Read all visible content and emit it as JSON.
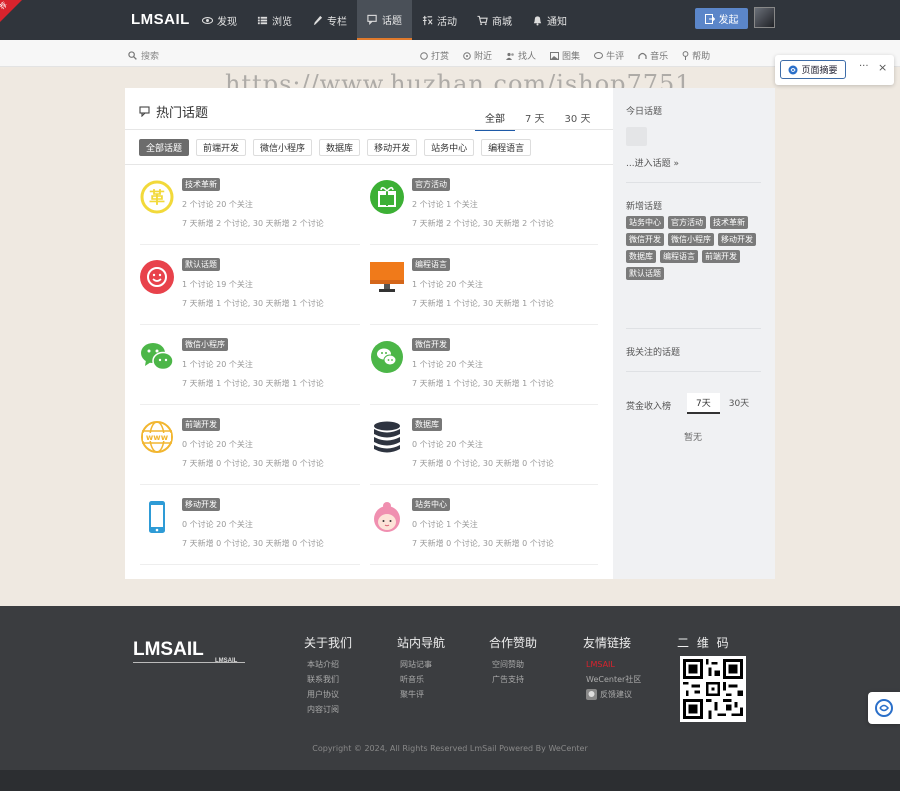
{
  "corner_badge": "荐",
  "header": {
    "logo": "LMSAIL",
    "nav": [
      {
        "label": "发现",
        "icon": "eye-icon"
      },
      {
        "label": "浏览",
        "icon": "list-icon"
      },
      {
        "label": "专栏",
        "icon": "pen-icon"
      },
      {
        "label": "话题",
        "icon": "chat-icon",
        "active": true
      },
      {
        "label": "活动",
        "icon": "activity-icon"
      },
      {
        "label": "商城",
        "icon": "cart-icon"
      },
      {
        "label": "通知",
        "icon": "bell-icon"
      }
    ],
    "publish_label": "发起"
  },
  "subbar": {
    "search_placeholder": "搜索",
    "links": [
      {
        "label": "打赏",
        "icon": "coin-icon"
      },
      {
        "label": "附近",
        "icon": "location-icon"
      },
      {
        "label": "找人",
        "icon": "people-icon"
      },
      {
        "label": "图集",
        "icon": "image-icon"
      },
      {
        "label": "牛评",
        "icon": "comment-icon"
      },
      {
        "label": "音乐",
        "icon": "headphones-icon"
      },
      {
        "label": "帮助",
        "icon": "pin-icon"
      }
    ]
  },
  "popup": {
    "summary_label": "页面摘要",
    "more": "···",
    "close": "×"
  },
  "watermark": "https://www.huzhan.com/ishop7751",
  "main": {
    "title": "热门话题",
    "tabs": [
      "全部",
      "7 天",
      "30 天"
    ],
    "active_tab": "全部",
    "categories": [
      "全部话题",
      "前端开发",
      "微信小程序",
      "数据库",
      "移动开发",
      "站务中心",
      "编程语言"
    ],
    "active_category": "全部话题",
    "topics": [
      {
        "tag": "技术革新",
        "stats": "2 个讨论 20 个关注",
        "recent": "7 天新增 2 个讨论, 30 天新增 2 个讨论",
        "icon": "revolution-icon",
        "color": "#f2d93a"
      },
      {
        "tag": "官方活动",
        "stats": "2 个讨论 1 个关注",
        "recent": "7 天新增 2 个讨论, 30 天新增 2 个讨论",
        "icon": "gift-icon",
        "color": "#3cb035"
      },
      {
        "tag": "默认话题",
        "stats": "1 个讨论 19 个关注",
        "recent": "7 天新增 1 个讨论, 30 天新增 1 个讨论",
        "icon": "smiley-icon",
        "color": "#e8424b"
      },
      {
        "tag": "编程语言",
        "stats": "1 个讨论 20 个关注",
        "recent": "7 天新增 1 个讨论, 30 天新增 1 个讨论",
        "icon": "monitor-icon",
        "color": "#f07a1a"
      },
      {
        "tag": "微信小程序",
        "stats": "1 个讨论 20 个关注",
        "recent": "7 天新增 1 个讨论, 30 天新增 1 个讨论",
        "icon": "wechat-icon",
        "color": "#4cb648"
      },
      {
        "tag": "微信开发",
        "stats": "1 个讨论 20 个关注",
        "recent": "7 天新增 1 个讨论, 30 天新增 1 个讨论",
        "icon": "wechat-round-icon",
        "color": "#4cb648"
      },
      {
        "tag": "前端开发",
        "stats": "0 个讨论 20 个关注",
        "recent": "7 天新增 0 个讨论, 30 天新增 0 个讨论",
        "icon": "www-icon",
        "color": "#f2b630"
      },
      {
        "tag": "数据库",
        "stats": "0 个讨论 20 个关注",
        "recent": "7 天新增 0 个讨论, 30 天新增 0 个讨论",
        "icon": "database-icon",
        "color": "#2e3440"
      },
      {
        "tag": "移动开发",
        "stats": "0 个讨论 20 个关注",
        "recent": "7 天新增 0 个讨论, 30 天新增 0 个讨论",
        "icon": "phone-icon",
        "color": "#2e9bd6"
      },
      {
        "tag": "站务中心",
        "stats": "0 个讨论 1 个关注",
        "recent": "7 天新增 0 个讨论, 30 天新增 0 个讨论",
        "icon": "girl-icon",
        "color": "#f08fb0"
      }
    ]
  },
  "sidebar": {
    "today_title": "今日话题",
    "enter_link": "...进入话题 »",
    "new_title": "新增话题",
    "new_tags": [
      "站务中心",
      "官方活动",
      "技术革新",
      "微信开发",
      "微信小程序",
      "移动开发",
      "数据库",
      "编程语言",
      "前端开发",
      "默认话题"
    ],
    "followed_title": "我关注的话题",
    "rank_title": "赏金收入榜",
    "rank_tabs": [
      "7天",
      "30天"
    ],
    "rank_active": "7天",
    "rank_empty": "暂无"
  },
  "footer": {
    "logo": "LMSAIL",
    "logo_sub": "LMSAIL",
    "columns": [
      {
        "title": "关于我们",
        "items": [
          "本站介绍",
          "联系我们",
          "用户协议",
          "内容订阅"
        ]
      },
      {
        "title": "站内导航",
        "items": [
          "网站记事",
          "听音乐",
          "聚牛评"
        ]
      },
      {
        "title": "合作赞助",
        "items": [
          "空间赞助",
          "广告支持"
        ]
      },
      {
        "title": "友情链接",
        "items": [
          "LMSAIL",
          "WeCenter社区",
          "反馈建议"
        ]
      }
    ],
    "qr_title": "二 维 码",
    "copyright": "Copyright © 2024, All Rights Reserved LmSail Powered By WeCenter"
  }
}
